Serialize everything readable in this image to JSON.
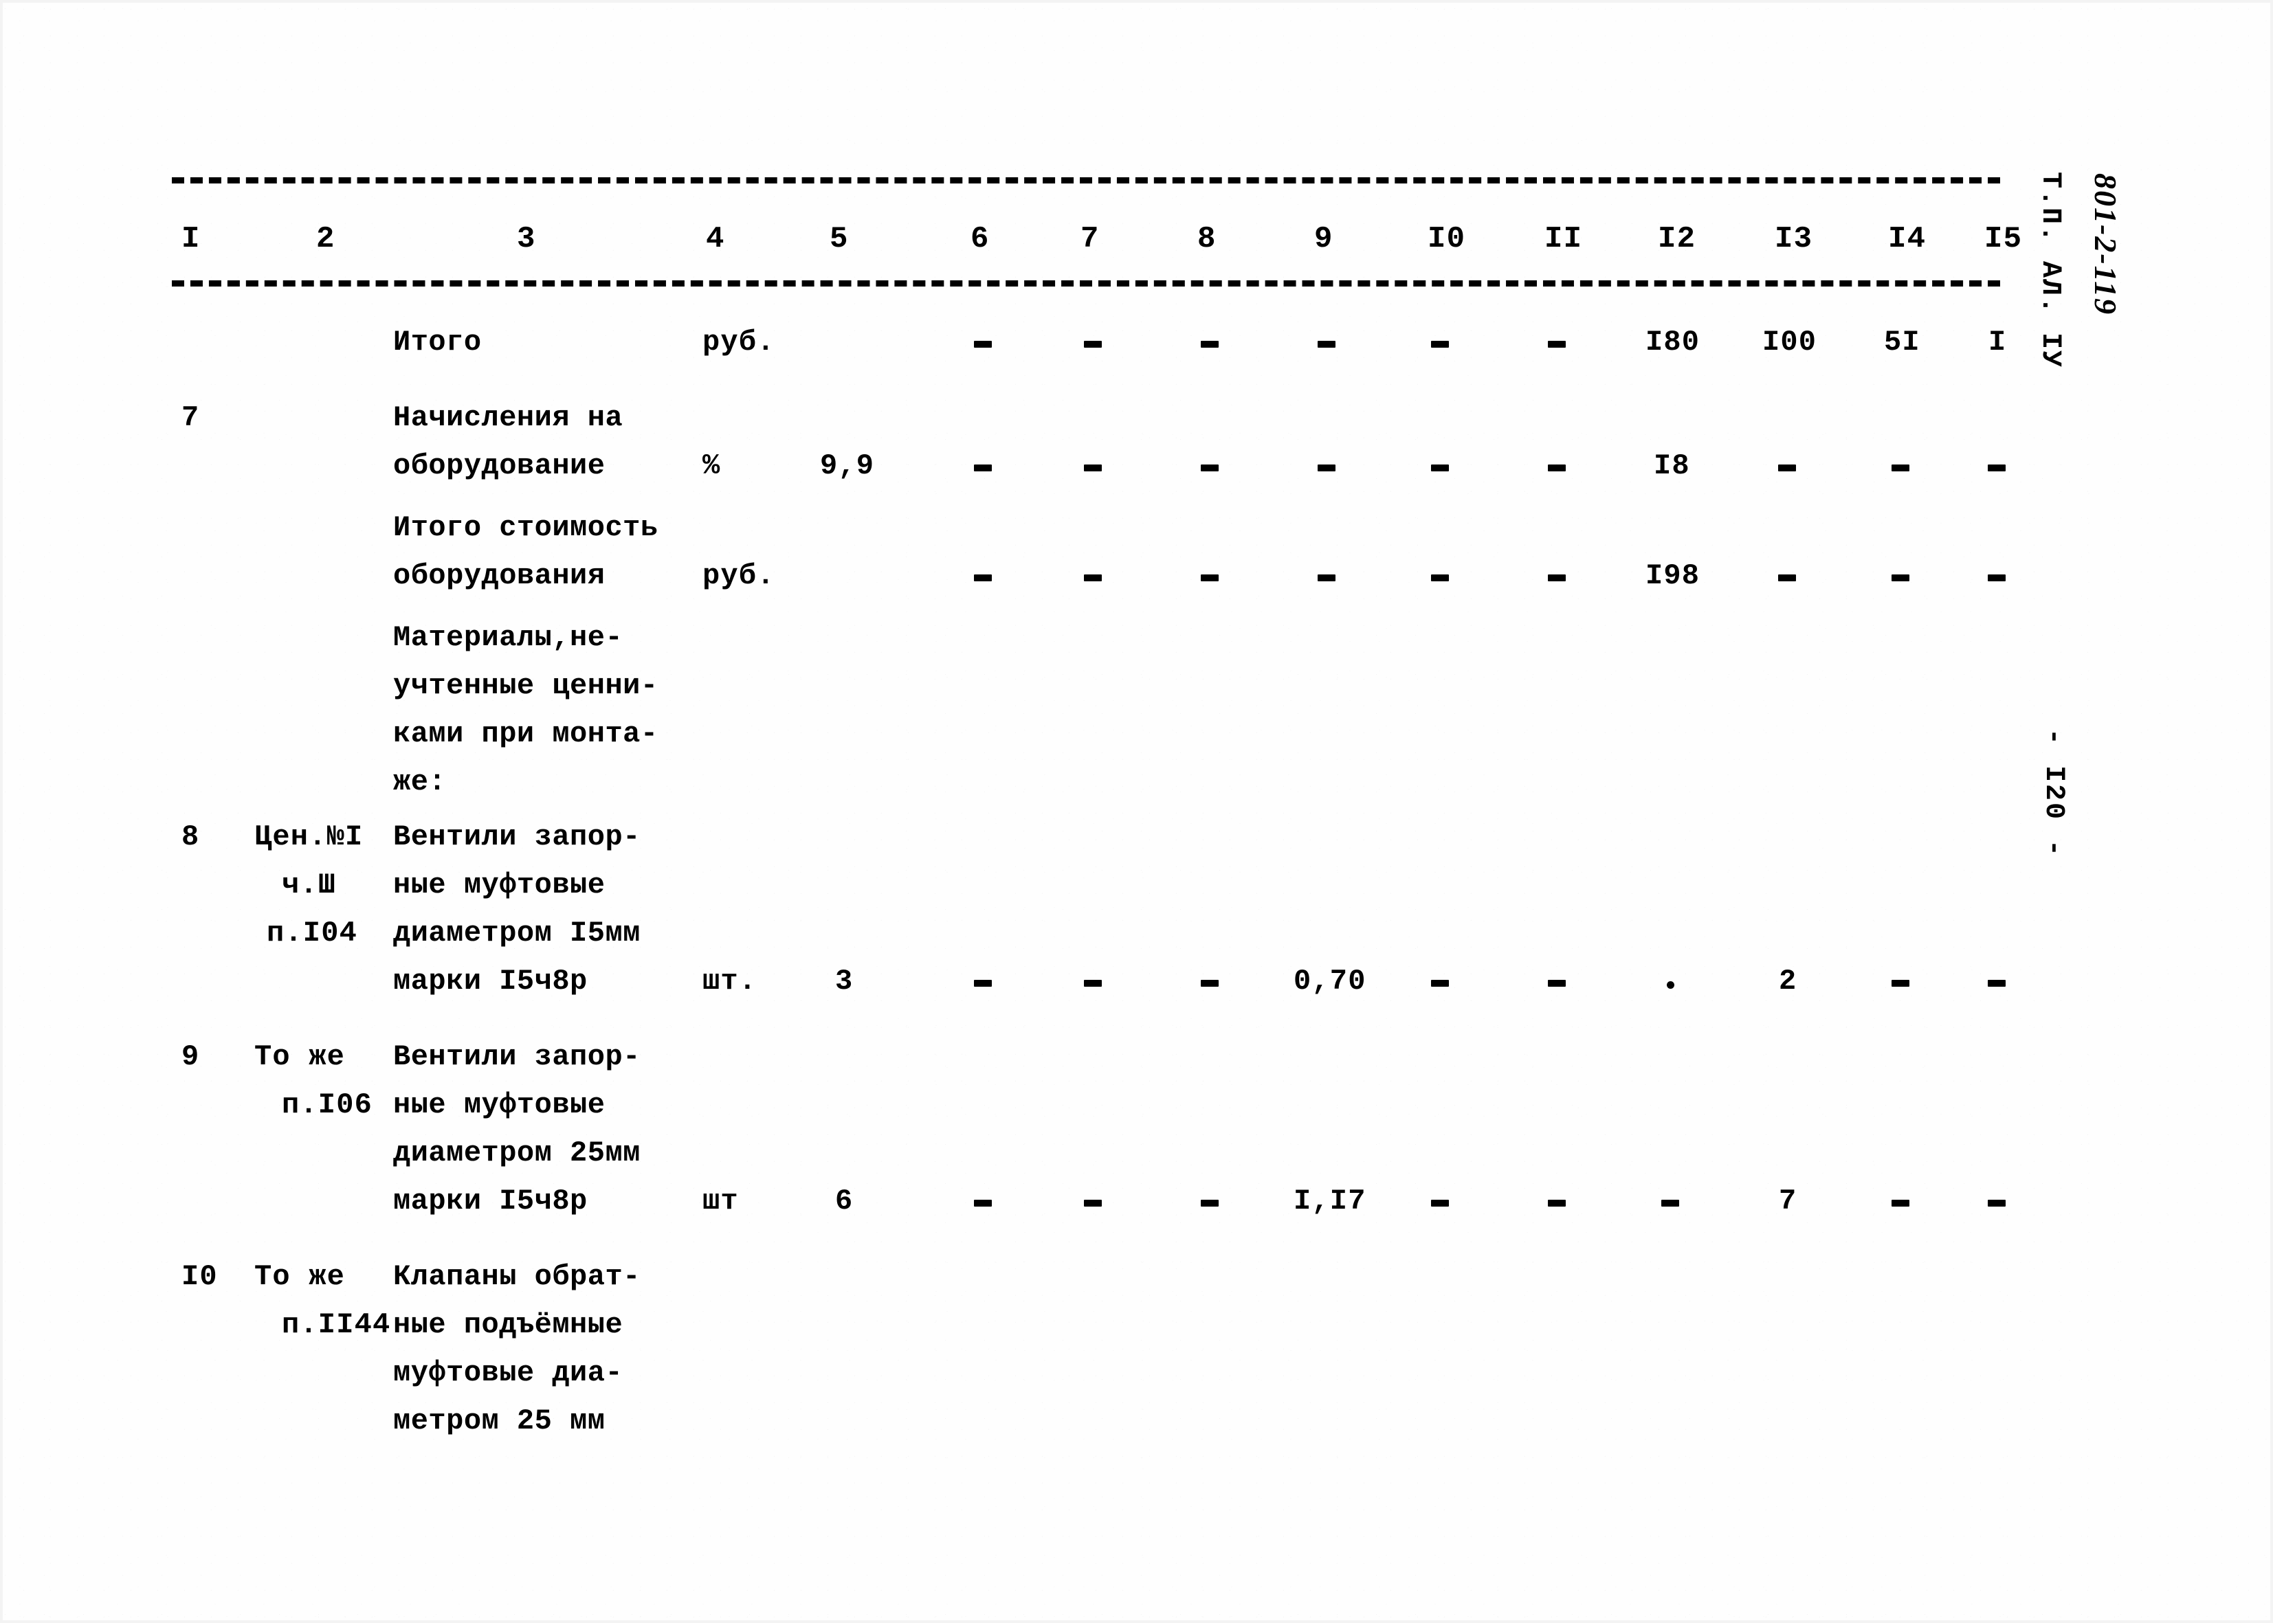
{
  "document": {
    "margin_code": "Т.П. АЛ. IУ",
    "handwritten_code": "801-2-119",
    "page_number": "- I20 -"
  },
  "table": {
    "column_numbers": [
      "I",
      "2",
      "3",
      "4",
      "5",
      "6",
      "7",
      "8",
      "9",
      "I0",
      "II",
      "I2",
      "I3",
      "I4",
      "I5"
    ],
    "rows": [
      {
        "id": "row-itogo",
        "no": "",
        "code_lines": [],
        "desc_lines": [
          "Итого"
        ],
        "unit": "руб.",
        "qty": "",
        "c6": "-",
        "c7": "-",
        "c8": "-",
        "c9": "-",
        "c10": "-",
        "c11": "-",
        "c12": "I80",
        "c13": "I00",
        "c14": "5I",
        "c15": "I"
      },
      {
        "id": "row-7",
        "no": "7",
        "code_lines": [],
        "desc_lines": [
          "Начисления на",
          "оборудование"
        ],
        "unit": "%",
        "qty": "9,9",
        "c6": "-",
        "c7": "-",
        "c8": "-",
        "c9": "-",
        "c10": "-",
        "c11": "-",
        "c12": "I8",
        "c13": "-",
        "c14": "-",
        "c15": "-"
      },
      {
        "id": "row-itogo-stoimost",
        "no": "",
        "code_lines": [],
        "desc_lines": [
          "Итого стоимость",
          "оборудования"
        ],
        "unit": "руб.",
        "qty": "",
        "c6": "-",
        "c7": "-",
        "c8": "-",
        "c9": "-",
        "c10": "-",
        "c11": "-",
        "c12": "I98",
        "c13": "-",
        "c14": "-",
        "c15": "-"
      },
      {
        "id": "row-materialy",
        "no": "",
        "code_lines": [],
        "desc_lines": [
          "Материалы,не-",
          "учтенные ценни-",
          "ками при монта-",
          "же:"
        ],
        "unit": "",
        "qty": "",
        "c6": "",
        "c7": "",
        "c8": "",
        "c9": "",
        "c10": "",
        "c11": "",
        "c12": "",
        "c13": "",
        "c14": "",
        "c15": ""
      },
      {
        "id": "row-8",
        "no": "8",
        "code_lines": [
          "Цен.№I",
          "ч.Ш",
          "п.I04"
        ],
        "desc_lines": [
          "Вентили запор-",
          "ные муфтовые",
          "диаметром I5мм",
          "марки I5ч8р"
        ],
        "unit": "шт.",
        "qty": "3",
        "c6": "-",
        "c7": "-",
        "c8": "-",
        "c9": "0,70",
        "c10": "-",
        "c11": "-",
        "c12": ".",
        "c13": "2",
        "c14": "-",
        "c15": "-"
      },
      {
        "id": "row-9",
        "no": "9",
        "code_lines": [
          "То же",
          "п.I06"
        ],
        "desc_lines": [
          "Вентили запор-",
          "ные муфтовые",
          "диаметром 25мм",
          "марки I5ч8р"
        ],
        "unit": "шт",
        "qty": "6",
        "c6": "-",
        "c7": "-",
        "c8": "-",
        "c9": "I,I7",
        "c10": "-",
        "c11": "-",
        "c12": "-",
        "c13": "7",
        "c14": "-",
        "c15": "-"
      },
      {
        "id": "row-10",
        "no": "I0",
        "code_lines": [
          "То же",
          "п.II44"
        ],
        "desc_lines": [
          "Клапаны обрат-",
          "ные подъёмные",
          "муфтовые диа-",
          "метром 25 мм"
        ],
        "unit": "",
        "qty": "",
        "c6": "",
        "c7": "",
        "c8": "",
        "c9": "",
        "c10": "",
        "c11": "",
        "c12": "",
        "c13": "",
        "c14": "",
        "c15": ""
      }
    ]
  },
  "colors": {
    "ink": "#000000",
    "paper": "#ffffff"
  }
}
